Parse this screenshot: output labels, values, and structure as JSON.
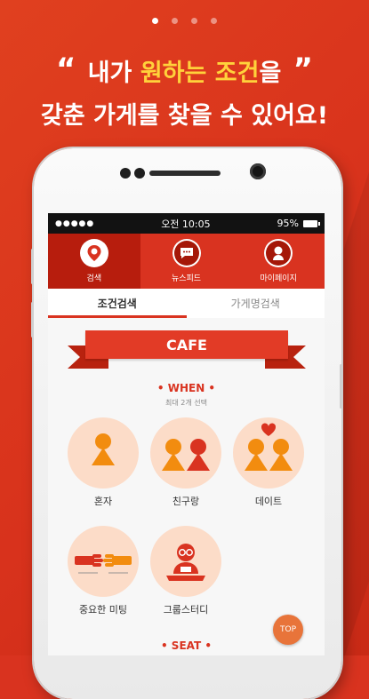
{
  "pagination": {
    "total": 4,
    "active": 0
  },
  "headline": {
    "line1_a": "내가 ",
    "line1_hl1": "원하는",
    "line1_b": " ",
    "line1_hl2": "조건",
    "line1_c": "을",
    "line2": "갖춘 가게를 찾을 수 있어요!",
    "quote_open": "“",
    "quote_close": "”"
  },
  "status_bar": {
    "signal": "●●●●●",
    "time": "오전 10:05",
    "battery": "95%"
  },
  "nav": {
    "items": [
      {
        "label": "검색",
        "icon": "map-pin-icon"
      },
      {
        "label": "뉴스피드",
        "icon": "chat-bubble-icon"
      },
      {
        "label": "마이페이지",
        "icon": "user-icon"
      }
    ]
  },
  "tabs": {
    "condition": "조건검색",
    "store_name": "가게명검색"
  },
  "banner": {
    "text": "CAFE"
  },
  "when": {
    "title": "• WHEN •",
    "subtitle": "최대 2개 선택",
    "options": [
      {
        "label": "혼자"
      },
      {
        "label": "친구랑"
      },
      {
        "label": "데이트"
      },
      {
        "label": "중요한 미팅"
      },
      {
        "label": "그룹스터디"
      }
    ]
  },
  "seat": {
    "title": "• SEAT •"
  },
  "top_button": {
    "label": "TOP"
  },
  "colors": {
    "accent": "#d93320",
    "highlight": "#ffd23b",
    "option_bg": "#fcdcc8"
  }
}
